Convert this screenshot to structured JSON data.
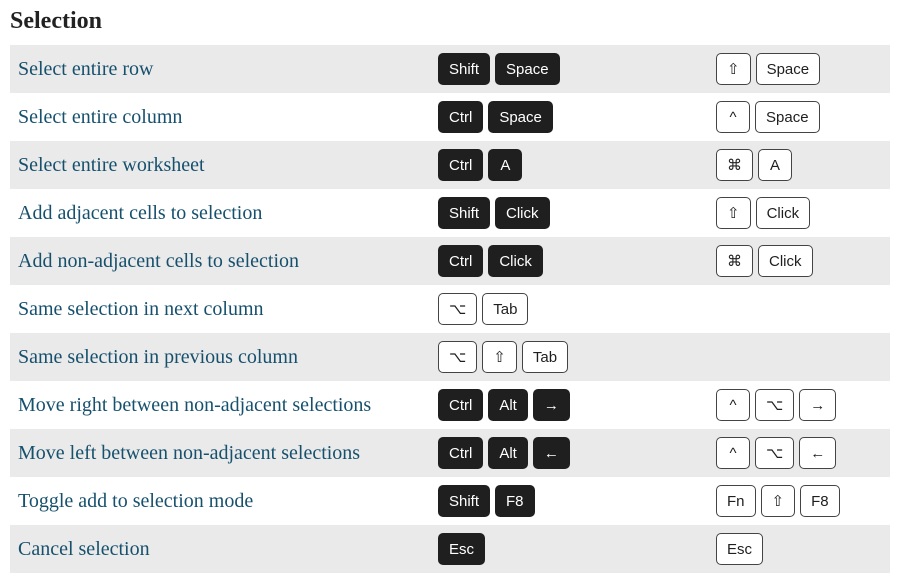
{
  "title": "Selection",
  "rows": [
    {
      "label": "Select entire row",
      "a": [
        {
          "t": "Shift",
          "s": "dark"
        },
        {
          "t": "Space",
          "s": "dark"
        }
      ],
      "b": [
        {
          "t": "⇧",
          "s": "light"
        },
        {
          "t": "Space",
          "s": "light"
        }
      ]
    },
    {
      "label": "Select entire column",
      "a": [
        {
          "t": "Ctrl",
          "s": "dark"
        },
        {
          "t": "Space",
          "s": "dark"
        }
      ],
      "b": [
        {
          "t": "^",
          "s": "light"
        },
        {
          "t": "Space",
          "s": "light"
        }
      ]
    },
    {
      "label": "Select entire worksheet",
      "a": [
        {
          "t": "Ctrl",
          "s": "dark"
        },
        {
          "t": "A",
          "s": "dark"
        }
      ],
      "b": [
        {
          "t": "⌘",
          "s": "light"
        },
        {
          "t": "A",
          "s": "light"
        }
      ]
    },
    {
      "label": "Add adjacent cells to selection",
      "a": [
        {
          "t": "Shift",
          "s": "dark"
        },
        {
          "t": "Click",
          "s": "dark"
        }
      ],
      "b": [
        {
          "t": "⇧",
          "s": "light"
        },
        {
          "t": "Click",
          "s": "light"
        }
      ]
    },
    {
      "label": "Add non-adjacent cells to selection",
      "a": [
        {
          "t": "Ctrl",
          "s": "dark"
        },
        {
          "t": "Click",
          "s": "dark"
        }
      ],
      "b": [
        {
          "t": "⌘",
          "s": "light"
        },
        {
          "t": "Click",
          "s": "light"
        }
      ]
    },
    {
      "label": "Same selection in next column",
      "a": [
        {
          "t": "⌥",
          "s": "light"
        },
        {
          "t": "Tab",
          "s": "light"
        }
      ],
      "b": []
    },
    {
      "label": "Same selection in previous column",
      "a": [
        {
          "t": "⌥",
          "s": "light"
        },
        {
          "t": "⇧",
          "s": "light"
        },
        {
          "t": "Tab",
          "s": "light"
        }
      ],
      "b": []
    },
    {
      "label": "Move right between non-adjacent selections",
      "a": [
        {
          "t": "Ctrl",
          "s": "dark"
        },
        {
          "t": "Alt",
          "s": "dark"
        },
        {
          "t": "→",
          "s": "dark"
        }
      ],
      "b": [
        {
          "t": "^",
          "s": "light"
        },
        {
          "t": "⌥",
          "s": "light"
        },
        {
          "t": "→",
          "s": "light"
        }
      ]
    },
    {
      "label": "Move left between non-adjacent selections",
      "a": [
        {
          "t": "Ctrl",
          "s": "dark"
        },
        {
          "t": "Alt",
          "s": "dark"
        },
        {
          "t": "←",
          "s": "dark"
        }
      ],
      "b": [
        {
          "t": "^",
          "s": "light"
        },
        {
          "t": "⌥",
          "s": "light"
        },
        {
          "t": "←",
          "s": "light"
        }
      ]
    },
    {
      "label": "Toggle add to selection mode",
      "a": [
        {
          "t": "Shift",
          "s": "dark"
        },
        {
          "t": "F8",
          "s": "dark"
        }
      ],
      "b": [
        {
          "t": "Fn",
          "s": "light"
        },
        {
          "t": "⇧",
          "s": "light"
        },
        {
          "t": "F8",
          "s": "light"
        }
      ]
    },
    {
      "label": "Cancel selection",
      "a": [
        {
          "t": "Esc",
          "s": "dark"
        }
      ],
      "b": [
        {
          "t": "Esc",
          "s": "light"
        }
      ]
    }
  ]
}
